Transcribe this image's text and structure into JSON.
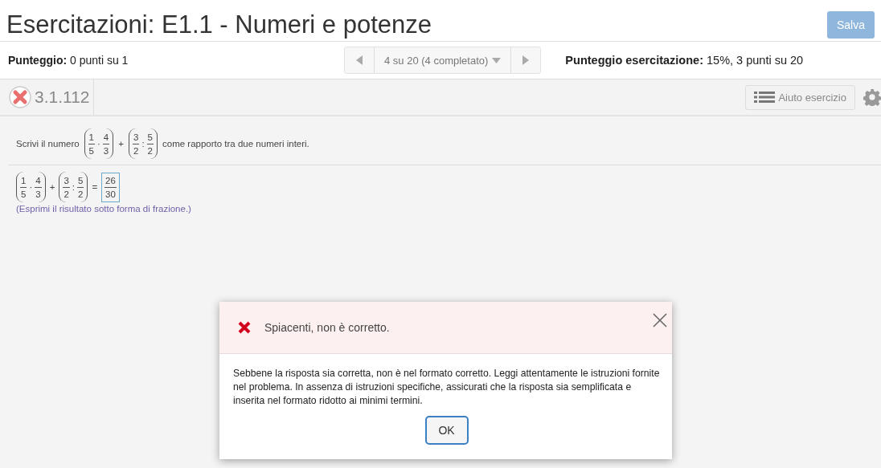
{
  "header": {
    "title": "Esercitazioni: E1.1 - Numeri e potenze",
    "save_button": "Salva"
  },
  "score": {
    "label": "Punteggio:",
    "value": "0 punti su 1"
  },
  "navigator": {
    "position": "4 su 20 (4 completato)"
  },
  "exercise_score": {
    "label": "Punteggio esercitazione:",
    "value": "15%, 3 punti su 20"
  },
  "exercise": {
    "correct": false,
    "number": "3.1.112",
    "help_button": "Aiuto esercizio"
  },
  "question": {
    "before": "Scrivi il numero",
    "after": "come rapporto tra due numeri interi.",
    "expression": [
      {
        "kind": "group",
        "items": [
          {
            "kind": "frac",
            "num": "1",
            "den": "5"
          },
          {
            "kind": "op",
            "text": "·"
          },
          {
            "kind": "frac",
            "num": "4",
            "den": "3"
          }
        ]
      },
      {
        "kind": "op",
        "text": "+"
      },
      {
        "kind": "group",
        "items": [
          {
            "kind": "frac",
            "num": "3",
            "den": "2"
          },
          {
            "kind": "op",
            "text": ":"
          },
          {
            "kind": "frac",
            "num": "5",
            "den": "2"
          }
        ]
      }
    ]
  },
  "answer": {
    "expression": [
      {
        "kind": "group",
        "items": [
          {
            "kind": "frac",
            "num": "1",
            "den": "5"
          },
          {
            "kind": "op",
            "text": "·"
          },
          {
            "kind": "frac",
            "num": "4",
            "den": "3"
          }
        ]
      },
      {
        "kind": "op",
        "text": "+"
      },
      {
        "kind": "group",
        "items": [
          {
            "kind": "frac",
            "num": "3",
            "den": "2"
          },
          {
            "kind": "op",
            "text": ":"
          },
          {
            "kind": "frac",
            "num": "5",
            "den": "2"
          }
        ]
      },
      {
        "kind": "op",
        "text": "="
      }
    ],
    "input": {
      "num": "26",
      "den": "30"
    },
    "hint": "(Esprimi il risultato sotto forma di frazione.)"
  },
  "dialog": {
    "title": "Spiacenti, non è corretto.",
    "message": "Sebbene la risposta sia corretta, non è nel formato corretto. Leggi attentamente le istruzioni fornite nel problema. In assenza di istruzioni specifiche, assicurati che la risposta sia semplificata e inserita nel formato ridotto ai minimi termini.",
    "ok_button": "OK"
  }
}
